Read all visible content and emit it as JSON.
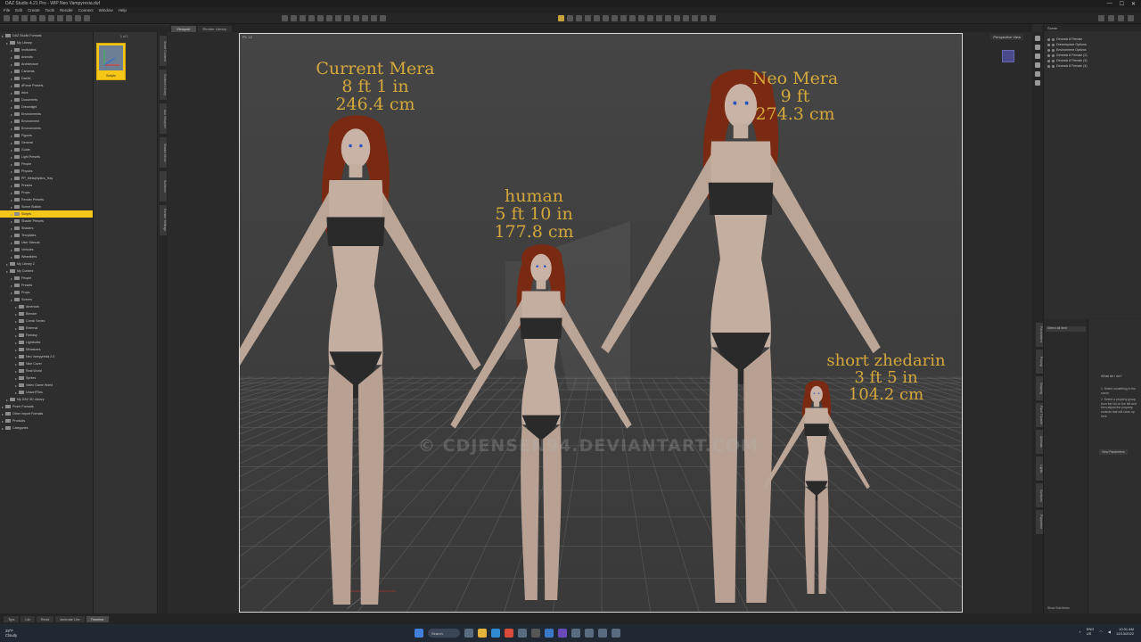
{
  "window": {
    "title": "DAZ Studio 4.21 Pro - WIP Neo Vampyrexia.duf"
  },
  "menu": [
    "File",
    "Edit",
    "Create",
    "Tools",
    "Render",
    "Connect",
    "Window",
    "Help"
  ],
  "left_tree": {
    "items": [
      {
        "label": "DAZ Studio Formats",
        "level": 0
      },
      {
        "label": "My Library",
        "level": 1
      },
      {
        "label": "!extfolders",
        "level": 2
      },
      {
        "label": "Animals",
        "level": 2
      },
      {
        "label": "Architecture",
        "level": 2
      },
      {
        "label": "Cameras",
        "level": 2
      },
      {
        "label": "Daz3d",
        "level": 2
      },
      {
        "label": "dForce Presets",
        "level": 2
      },
      {
        "label": "docs",
        "level": 2
      },
      {
        "label": "Documents",
        "level": 2
      },
      {
        "label": "Dreamlight",
        "level": 2
      },
      {
        "label": "Environments",
        "level": 2
      },
      {
        "label": "Environment",
        "level": 2
      },
      {
        "label": "Environments",
        "level": 2
      },
      {
        "label": "Figures",
        "level": 2
      },
      {
        "label": "General",
        "level": 2
      },
      {
        "label": "Guide",
        "level": 2
      },
      {
        "label": "Light Presets",
        "level": 2
      },
      {
        "label": "People",
        "level": 2
      },
      {
        "label": "Physics",
        "level": 2
      },
      {
        "label": "PP_Metaphysics_Hay",
        "level": 2
      },
      {
        "label": "Presets",
        "level": 2
      },
      {
        "label": "Props",
        "level": 2
      },
      {
        "label": "Render Presets",
        "level": 2
      },
      {
        "label": "Scene Builder",
        "level": 2
      },
      {
        "label": "Scripts",
        "level": 2,
        "selected": true
      },
      {
        "label": "Shader Presets",
        "level": 2
      },
      {
        "label": "Shaders",
        "level": 2
      },
      {
        "label": "Templates",
        "level": 2
      },
      {
        "label": "User Manual",
        "level": 2
      },
      {
        "label": "Vehicles",
        "level": 2
      },
      {
        "label": "Wearables",
        "level": 2
      },
      {
        "label": "My Library 2",
        "level": 1
      },
      {
        "label": "My Content",
        "level": 1
      },
      {
        "label": "People",
        "level": 2
      },
      {
        "label": "Presets",
        "level": 2
      },
      {
        "label": "Props",
        "level": 2
      },
      {
        "label": "Scenes",
        "level": 2
      },
      {
        "label": "Americas",
        "level": 3
      },
      {
        "label": "Blender",
        "level": 3
      },
      {
        "label": "Comic Series",
        "level": 3
      },
      {
        "label": "External",
        "level": 3
      },
      {
        "label": "Fantasy",
        "level": 3
      },
      {
        "label": "Lightbulbs",
        "level": 3
      },
      {
        "label": "Miniatures",
        "level": 3
      },
      {
        "label": "Neo Vampyrexia 2.0",
        "level": 3
      },
      {
        "label": "Nice Cover",
        "level": 3
      },
      {
        "label": "Real World",
        "level": 3
      },
      {
        "label": "Sprites",
        "level": 3
      },
      {
        "label": "Video Game World",
        "level": 3
      },
      {
        "label": "Unsort'Files",
        "level": 3
      },
      {
        "label": "My DAZ 3D Library",
        "level": 1
      },
      {
        "label": "Poser Formats",
        "level": 0
      },
      {
        "label": "Other Import Formats",
        "level": 0
      },
      {
        "label": "Products",
        "level": 0
      },
      {
        "label": "Categories",
        "level": 0
      }
    ]
  },
  "content": {
    "counter": "1 of 1",
    "thumb_label": "Scripts"
  },
  "left_vtabs": [
    "Smart Content",
    "Content Library",
    "Aux Viewport",
    "Shader Mixer",
    "Surfaces",
    "Render Settings"
  ],
  "viewport": {
    "tabs": [
      "Viewport",
      "Render Library"
    ],
    "active_tab": 0,
    "camera": "Perspective View",
    "corner": "PS. 12"
  },
  "labels": {
    "current": {
      "name": "Current Mera",
      "ft": "8 ft 1 in",
      "cm": "246.4 cm"
    },
    "human": {
      "name": "human",
      "ft": "5 ft 10 in",
      "cm": "177.8 cm"
    },
    "neo": {
      "name": "Neo Mera",
      "ft": "9 ft",
      "cm": "274.3 cm"
    },
    "short": {
      "name": "short zhedarin",
      "ft": "3 ft 5 in",
      "cm": "104.2 cm"
    }
  },
  "watermark": "© CDJENSEN94.DEVIANTART.COM",
  "scene": {
    "header": "Scene",
    "items": [
      "Genesis 8 Female",
      "Dreamspace Options",
      "Environment Options",
      "Genesis 8 Female (2)",
      "Genesis 8 Female (3)",
      "Genesis 8 Female (4)"
    ]
  },
  "params": {
    "dropdown": "Select all Item",
    "what_title": "What do I do?",
    "help_1": "1. Select something in the scene.",
    "help_2": "2. Select a property group from the list on the left and then adjust the property controls that will show up here.",
    "button": "View Parameters",
    "show_sub": "Show Sub Items"
  },
  "right_vtabs": [
    "Parameters",
    "Posing",
    "Shaping",
    "Face Transfer",
    "Animate",
    "Lights",
    "Surfaces",
    "Puppeteer"
  ],
  "bottom_tabs": [
    "Tips",
    "Lib",
    "Rend"
  ],
  "bottom_tabs2": [
    "Animate Lite",
    "Timeline"
  ],
  "taskbar": {
    "weather_temp": "29°F",
    "weather_desc": "Cloudy",
    "search": "Search",
    "lang": "ENG",
    "region": "US",
    "time": "10:31 AM",
    "date": "12/13/2022"
  },
  "colors": {
    "accent": "#f5c518",
    "label": "#d4a83a"
  }
}
